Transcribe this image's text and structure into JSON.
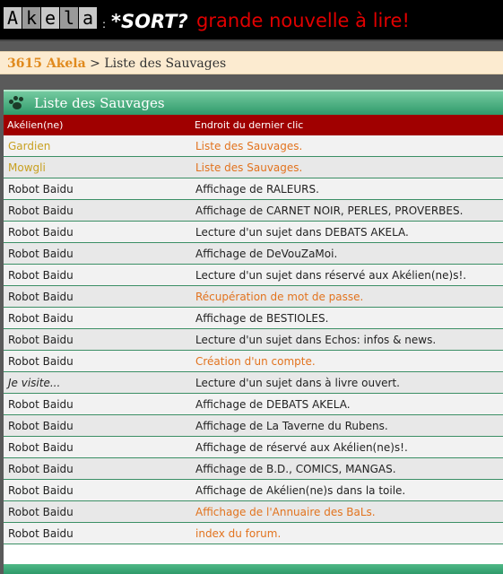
{
  "header": {
    "logo_letters": [
      "A",
      "k",
      "e",
      "l",
      "a"
    ],
    "colon": ":",
    "sort_label": "*SORT?",
    "headline": "grande nouvelle à lire!"
  },
  "breadcrumb": {
    "home": "3615 Akela",
    "separator": ">",
    "current": "Liste des Sauvages"
  },
  "panel": {
    "title": "Liste des Sauvages",
    "col_user": "Akélien(ne)",
    "col_location": "Endroit du dernier clic"
  },
  "rows": [
    {
      "user": "Gardien",
      "location": "Liste des Sauvages.",
      "user_style": "gold",
      "loc_style": "orange"
    },
    {
      "user": "Mowgli",
      "location": "Liste des Sauvages.",
      "user_style": "gold",
      "loc_style": "orange"
    },
    {
      "user": "Robot Baidu",
      "location": "Affichage de RALEURS.",
      "user_style": "",
      "loc_style": ""
    },
    {
      "user": "Robot Baidu",
      "location": "Affichage de CARNET NOIR, PERLES, PROVERBES.",
      "user_style": "",
      "loc_style": ""
    },
    {
      "user": "Robot Baidu",
      "location": "Lecture d'un sujet dans DEBATS AKELA.",
      "user_style": "",
      "loc_style": ""
    },
    {
      "user": "Robot Baidu",
      "location": "Affichage de DeVouZaMoi.",
      "user_style": "",
      "loc_style": ""
    },
    {
      "user": "Robot Baidu",
      "location": "Lecture d'un sujet dans réservé aux Akélien(ne)s!.",
      "user_style": "",
      "loc_style": ""
    },
    {
      "user": "Robot Baidu",
      "location": "Récupération de mot de passe.",
      "user_style": "",
      "loc_style": "orange"
    },
    {
      "user": "Robot Baidu",
      "location": "Affichage de BESTIOLES.",
      "user_style": "",
      "loc_style": ""
    },
    {
      "user": "Robot Baidu",
      "location": "Lecture d'un sujet dans Echos: infos & news.",
      "user_style": "",
      "loc_style": ""
    },
    {
      "user": "Robot Baidu",
      "location": "Création d'un compte.",
      "user_style": "",
      "loc_style": "orange"
    },
    {
      "user": "Je visite...",
      "location": "Lecture d'un sujet dans à livre ouvert.",
      "user_style": "ital",
      "loc_style": ""
    },
    {
      "user": "Robot Baidu",
      "location": "Affichage de DEBATS AKELA.",
      "user_style": "",
      "loc_style": ""
    },
    {
      "user": "Robot Baidu",
      "location": "Affichage de La Taverne du Rubens.",
      "user_style": "",
      "loc_style": ""
    },
    {
      "user": "Robot Baidu",
      "location": "Affichage de réservé aux Akélien(ne)s!.",
      "user_style": "",
      "loc_style": ""
    },
    {
      "user": "Robot Baidu",
      "location": "Affichage de B.D., COMICS,  MANGAS.",
      "user_style": "",
      "loc_style": ""
    },
    {
      "user": "Robot Baidu",
      "location": "Affichage de Akélien(ne)s dans la toile.",
      "user_style": "",
      "loc_style": ""
    },
    {
      "user": "Robot Baidu",
      "location": "Affichage de l'Annuaire des BaLs.",
      "user_style": "",
      "loc_style": "orange"
    },
    {
      "user": "Robot Baidu",
      "location": "index du forum.",
      "user_style": "",
      "loc_style": "orange"
    }
  ],
  "icons": {
    "panel_icon": "paw-print-icon"
  },
  "colors": {
    "headline_red": "#e00000",
    "breadcrumb_link": "#e08a1e",
    "header_row_red": "#a00000",
    "panel_green": "#2f9a6a",
    "link_orange": "#e2731e"
  }
}
